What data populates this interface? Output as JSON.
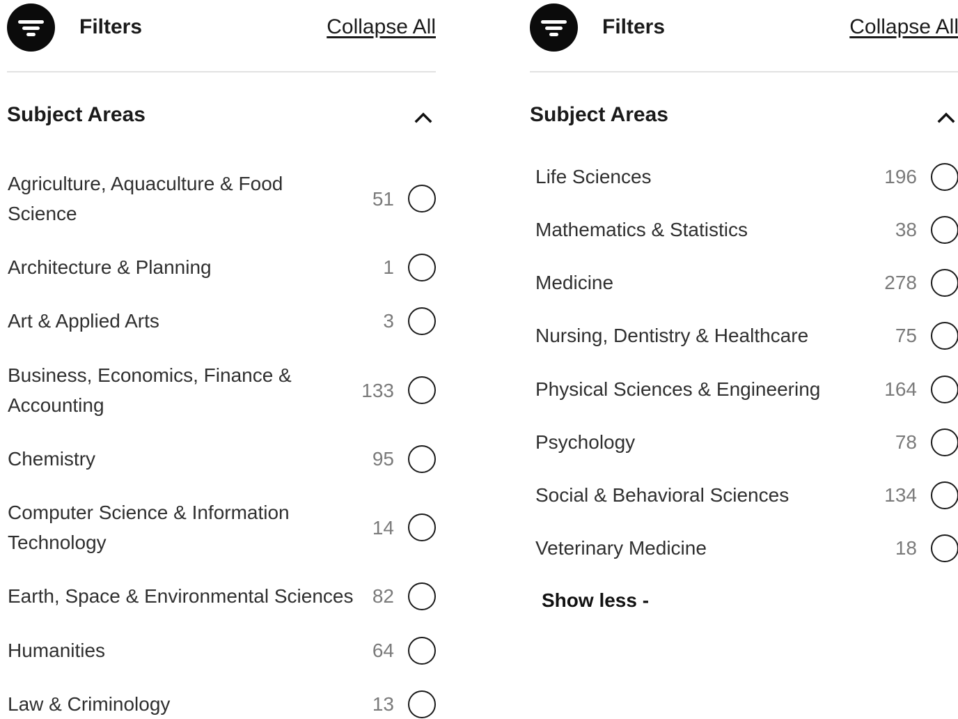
{
  "left_panel": {
    "header": {
      "icon": "filter-icon",
      "title": "Filters",
      "collapse_label": "Collapse All"
    },
    "section": {
      "title": "Subject Areas",
      "toggle_icon": "chevron-up-icon",
      "items": [
        {
          "label_line1": "Agriculture, Aquaculture & Food",
          "label_line2": "Science",
          "count": "51"
        },
        {
          "label_line1": "Architecture & Planning",
          "label_line2": "",
          "count": "1"
        },
        {
          "label_line1": "Art & Applied Arts",
          "label_line2": "",
          "count": "3"
        },
        {
          "label_line1": "Business, Economics, Finance &",
          "label_line2": "Accounting",
          "count": "133"
        },
        {
          "label_line1": "Chemistry",
          "label_line2": "",
          "count": "95"
        },
        {
          "label_line1": "Computer Science & Information",
          "label_line2": "Technology",
          "count": "14"
        },
        {
          "label_line1": "Earth, Space & Environmental Sciences",
          "label_line2": "",
          "count": "82"
        },
        {
          "label_line1": "Humanities",
          "label_line2": "",
          "count": "64"
        },
        {
          "label_line1": "Law & Criminology",
          "label_line2": "",
          "count": "13"
        }
      ]
    }
  },
  "right_panel": {
    "header": {
      "icon": "filter-icon",
      "title": "Filters",
      "collapse_label": "Collapse All"
    },
    "section": {
      "title": "Subject Areas",
      "toggle_icon": "chevron-up-icon",
      "items": [
        {
          "label_line1": "Life Sciences",
          "label_line2": "",
          "count": "196"
        },
        {
          "label_line1": "Mathematics & Statistics",
          "label_line2": "",
          "count": "38"
        },
        {
          "label_line1": "Medicine",
          "label_line2": "",
          "count": "278"
        },
        {
          "label_line1": "Nursing, Dentistry & Healthcare",
          "label_line2": "",
          "count": "75"
        },
        {
          "label_line1": "Physical Sciences & Engineering",
          "label_line2": "",
          "count": "164"
        },
        {
          "label_line1": "Psychology",
          "label_line2": "",
          "count": "78"
        },
        {
          "label_line1": "Social & Behavioral Sciences",
          "label_line2": "",
          "count": "134"
        },
        {
          "label_line1": "Veterinary Medicine",
          "label_line2": "",
          "count": "18"
        }
      ],
      "show_less_label": "Show less -"
    }
  },
  "colors": {
    "icon_background": "#0b0b0b",
    "divider": "#e2e2e2",
    "count_text": "#7a7a7a"
  }
}
